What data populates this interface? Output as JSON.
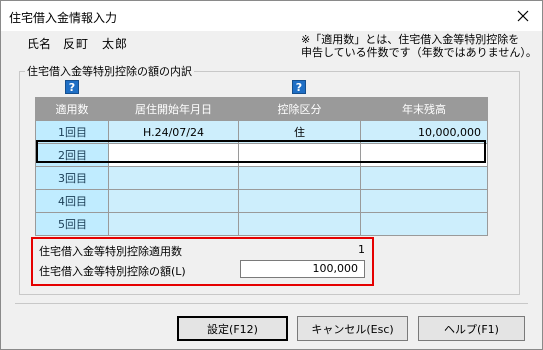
{
  "window": {
    "title": "住宅借入金情報入力"
  },
  "taxpayer": {
    "name_label": "氏名",
    "name": "反町　太郎"
  },
  "note": "※「適用数」とは、住宅借入金等特別控除を\n申告している件数です（年数ではありません）。",
  "group": {
    "legend": "住宅借入金等特別控除の額の内訳"
  },
  "help_icon_glyph": "?",
  "table": {
    "columns": [
      "適用数",
      "居住開始年月日",
      "控除区分",
      "年末残高"
    ],
    "rows": [
      {
        "label": "1回目",
        "date": "H.24/07/24",
        "type": "住",
        "balance": "10,000,000"
      },
      {
        "label": "2回目",
        "date": "",
        "type": "",
        "balance": ""
      },
      {
        "label": "3回目",
        "date": "",
        "type": "",
        "balance": ""
      },
      {
        "label": "4回目",
        "date": "",
        "type": "",
        "balance": ""
      },
      {
        "label": "5回目",
        "date": "",
        "type": "",
        "balance": ""
      }
    ]
  },
  "summary": {
    "count_label": "住宅借入金等特別控除適用数",
    "count_value": "1",
    "amount_label": "住宅借入金等特別控除の額(L)",
    "amount_value": "100,000"
  },
  "buttons": {
    "ok": "設定(F12)",
    "cancel": "キャンセル(Esc)",
    "help": "ヘルプ(F1)"
  },
  "colors": {
    "highlight_border": "#e50000",
    "help_icon": "#1f6fc5",
    "grid_cell": "#cdeefc"
  }
}
